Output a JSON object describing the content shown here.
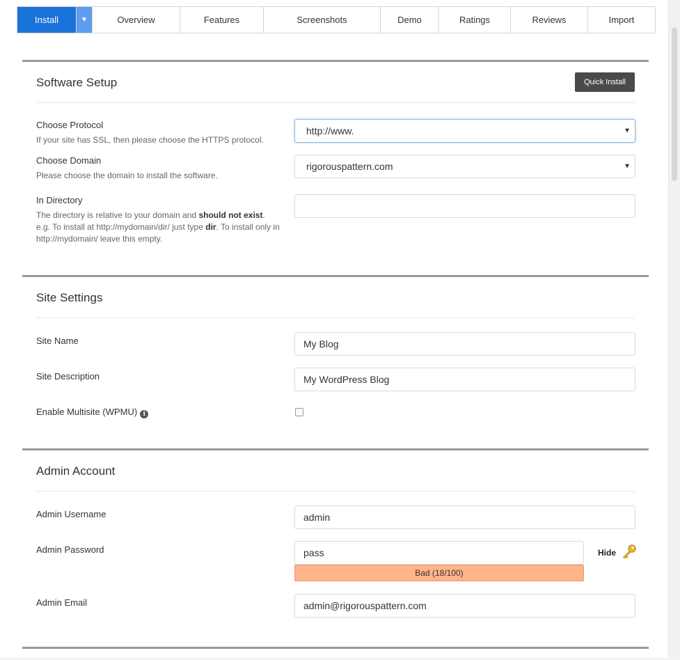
{
  "tabs": [
    {
      "label": "Install",
      "name": "tab-install"
    },
    {
      "label": "Overview",
      "name": "tab-overview"
    },
    {
      "label": "Features",
      "name": "tab-features"
    },
    {
      "label": "Screenshots",
      "name": "tab-screenshots"
    },
    {
      "label": "Demo",
      "name": "tab-demo"
    },
    {
      "label": "Ratings",
      "name": "tab-ratings"
    },
    {
      "label": "Reviews",
      "name": "tab-reviews"
    },
    {
      "label": "Import",
      "name": "tab-import"
    }
  ],
  "install_caret_icon": "caret-down-icon",
  "software_setup": {
    "title": "Software Setup",
    "quick_install_label": "Quick Install",
    "protocol": {
      "label": "Choose Protocol",
      "hint": "If your site has SSL, then please choose the HTTPS protocol.",
      "value": "http://www."
    },
    "domain": {
      "label": "Choose Domain",
      "hint": "Please choose the domain to install the software.",
      "value": "rigorouspattern.com"
    },
    "directory": {
      "label": "In Directory",
      "hint_1": "The directory is relative to your domain and ",
      "hint_bold_1": "should not exist",
      "hint_2": ". e.g. To install at http://mydomain/dir/ just type ",
      "hint_bold_2": "dir",
      "hint_3": ". To install only in http://mydomain/ leave this empty.",
      "value": ""
    }
  },
  "site_settings": {
    "title": "Site Settings",
    "site_name": {
      "label": "Site Name",
      "value": "My Blog"
    },
    "site_description": {
      "label": "Site Description",
      "value": "My WordPress Blog"
    },
    "multisite": {
      "label": "Enable Multisite (WPMU)",
      "checked": false
    }
  },
  "admin_account": {
    "title": "Admin Account",
    "username": {
      "label": "Admin Username",
      "value": "admin"
    },
    "password": {
      "label": "Admin Password",
      "value": "pass",
      "strength": "Bad (18/100)",
      "hide_label": "Hide"
    },
    "email": {
      "label": "Admin Email",
      "value": "admin@rigorouspattern.com"
    }
  },
  "colors": {
    "tab_active": "#1a73d9",
    "tab_caret": "#5d9df0",
    "strength_bad": "#ffb48a",
    "section_border": "#9a9a9a",
    "button_dark": "#4a4a4a"
  }
}
